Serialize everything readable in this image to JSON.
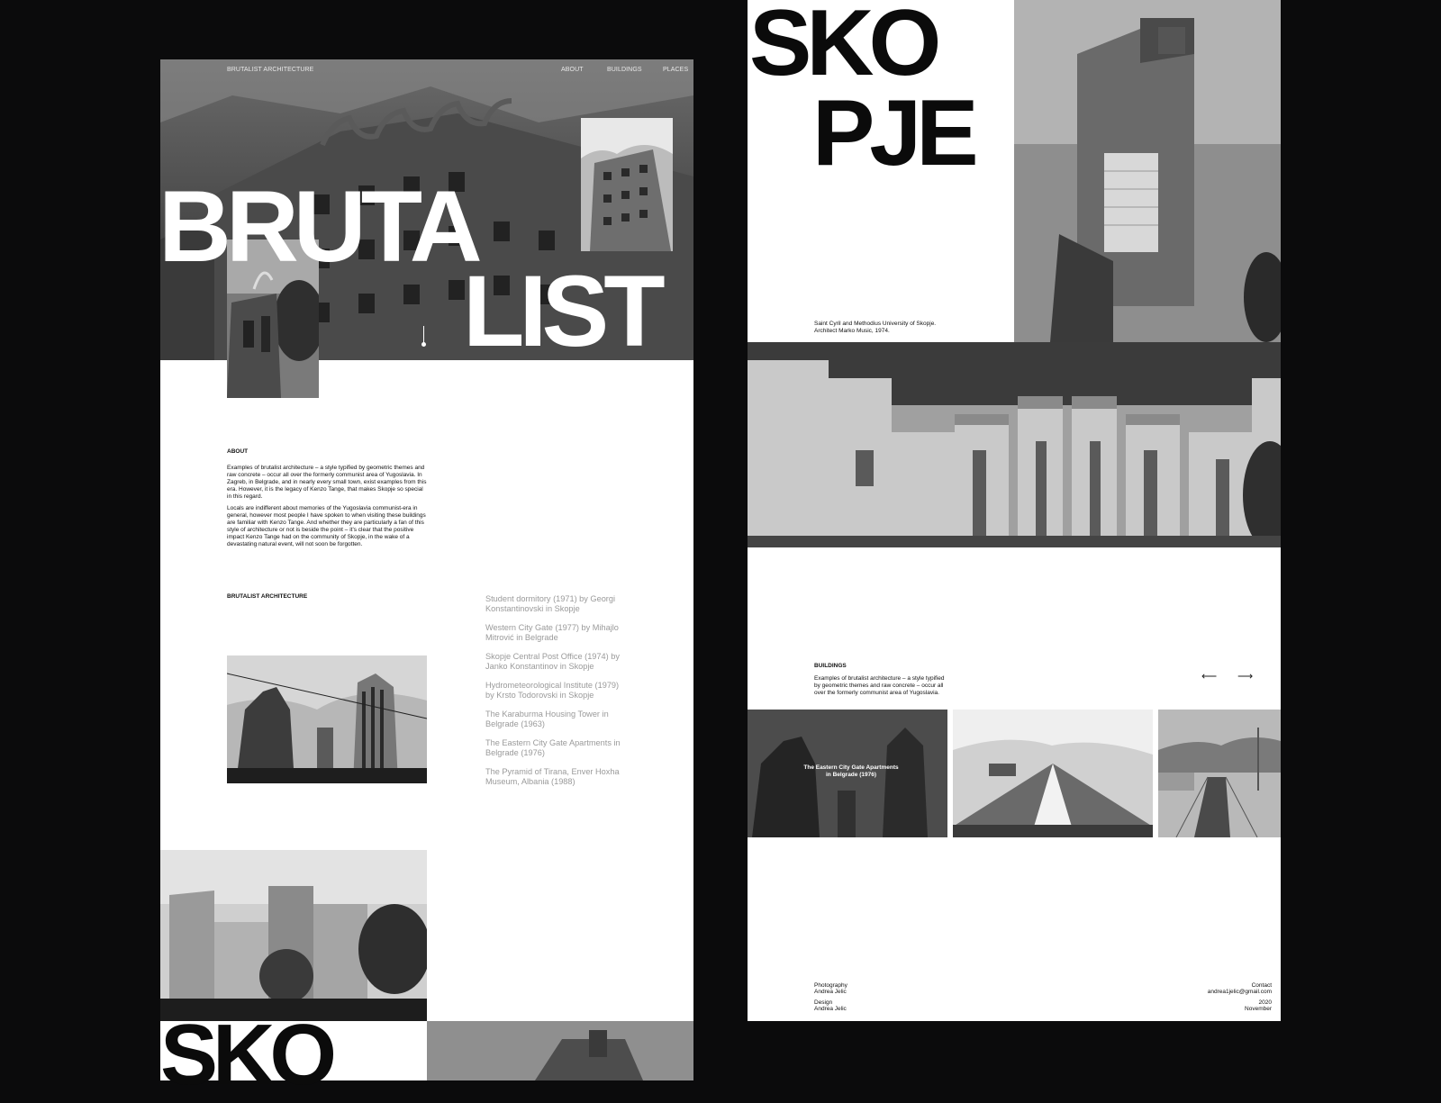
{
  "left_page": {
    "nav": {
      "brand": "BRUTALIST ARCHITECTURE",
      "links": [
        "ABOUT",
        "BUILDINGS",
        "PLACES"
      ]
    },
    "hero": {
      "line1": "BRUTA",
      "line2": "LIST"
    },
    "about": {
      "heading": "ABOUT",
      "paragraph1": "Examples of brutalist architecture – a style typified by geometric themes and raw concrete – occur all over the formerly communist area of Yugoslavia. In Zagreb, in Belgrade, and in nearly every small town, exist examples from this era. However, it is the legacy of Kenzo Tange, that makes Skopje so special in this regard.",
      "paragraph2": "Locals are indifferent about memories of the Yugoslavia communist-era in general, however most people I have spoken to when visiting these buildings are familiar with Kenzo Tange. And whether they are particularly a fan of this style of architecture or not is beside the point – it's clear that the positive impact Kenzo Tange had on the community of Skopje, in the wake of a devastating natural event, will not soon be forgotten."
    },
    "brutalist_list": {
      "heading": "BRUTALIST ARCHITECTURE",
      "items": [
        "Student dormitory (1971) by Georgi Konstantinovski in Skopje",
        "Western City Gate (1977) by Mihajlo Mitrović in Belgrade",
        "Skopje Central Post Office (1974) by Janko Konstantinov in Skopje",
        "Hydrometeorological Institute (1979) by Krsto Todorovski in Skopje",
        "The Karaburma Housing Tower in Belgrade (1963)",
        "The Eastern City Gate Apartments in Belgrade (1976)",
        "The Pyramid of Tirana, Enver Hoxha Museum, Albania (1988)"
      ]
    },
    "bottom_title": "SKO"
  },
  "right_page": {
    "title": {
      "line1": "SKO",
      "line2": "PJE"
    },
    "caption": "Saint Cyril and Methodius University of Skopje. Architect Marko Music, 1974.",
    "buildings": {
      "heading": "BUILDINGS",
      "text": "Examples of brutalist architecture – a style typified by geometric themes and raw concrete – occur all over the formerly communist area of Yugoslavia.",
      "prev_arrow": "⟵",
      "next_arrow": "⟶"
    },
    "gallery": [
      {
        "caption": "The Eastern City Gate Apartments in Belgrade (1976)"
      }
    ],
    "footer": {
      "photography_label": "Photography",
      "photography_name": "Andrea Jelic",
      "design_label": "Design",
      "design_name": "Andrea Jelic",
      "contact_label": "Contact",
      "contact_email": "andrea1jelic@gmail.com",
      "year": "2020",
      "month": "November"
    }
  },
  "colors": {
    "background": "#0b0b0c",
    "page": "#ffffff",
    "list_gray": "#9a9a9a"
  }
}
